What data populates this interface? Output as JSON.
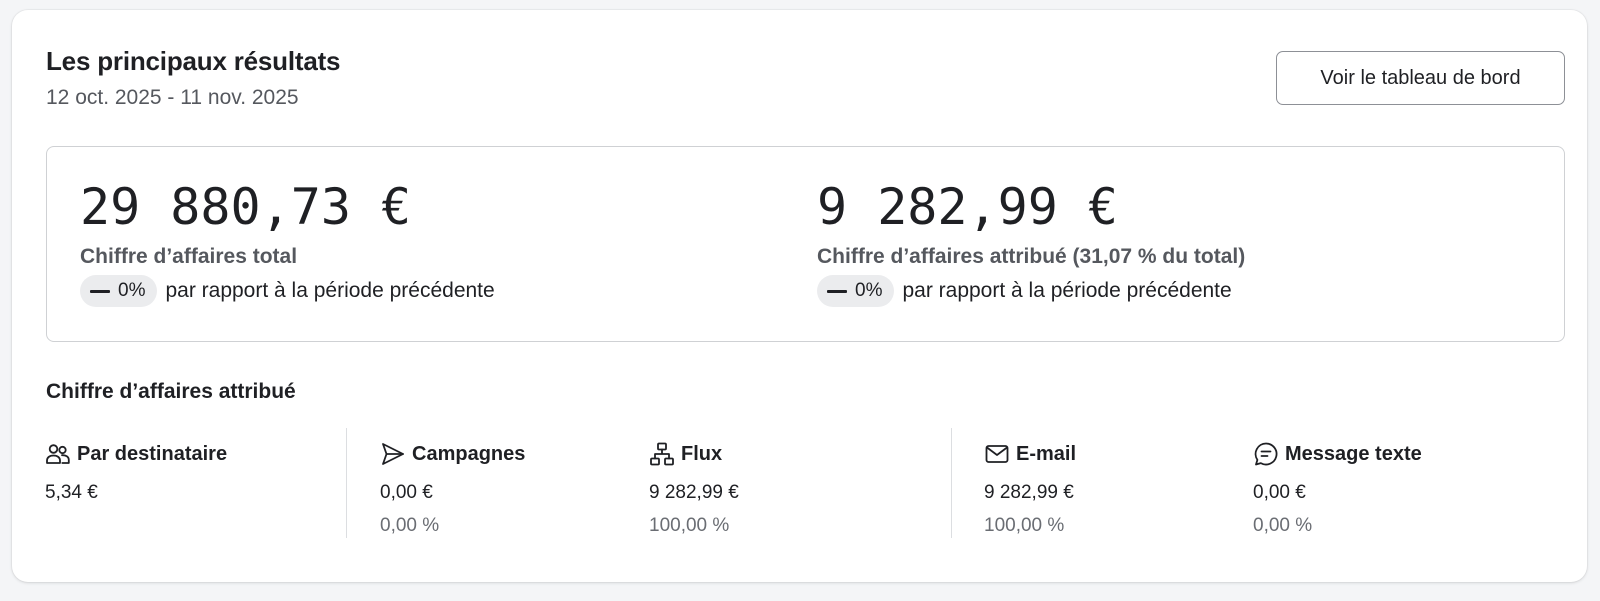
{
  "header": {
    "title": "Les principaux résultats",
    "date_range": "12 oct. 2025 - 11 nov. 2025",
    "dashboard_button": "Voir le tableau de bord"
  },
  "kpis": [
    {
      "value": "29 880,73 €",
      "label": "Chiffre d’affaires total",
      "change": "0%",
      "compare_text": "par rapport à la période précédente"
    },
    {
      "value": "9 282,99 €",
      "label": "Chiffre d’affaires attribué (31,07 % du total)",
      "change": "0%",
      "compare_text": "par rapport à la période précédente"
    }
  ],
  "attributed": {
    "title": "Chiffre d’affaires attribué",
    "stats": [
      {
        "icon": "users-icon",
        "name": "Par destinataire",
        "value": "5,34 €",
        "percent": ""
      },
      {
        "icon": "send-icon",
        "name": "Campagnes",
        "value": "0,00 €",
        "percent": "0,00 %"
      },
      {
        "icon": "flow-icon",
        "name": "Flux",
        "value": "9 282,99 €",
        "percent": "100,00 %"
      },
      {
        "icon": "mail-icon",
        "name": "E-mail",
        "value": "9 282,99 €",
        "percent": "100,00 %"
      },
      {
        "icon": "message-icon",
        "name": "Message texte",
        "value": "0,00 €",
        "percent": "0,00 %"
      }
    ]
  },
  "colors": {
    "card_background": "#ffffff",
    "page_background": "#f4f5f7",
    "text_primary": "#1f2024",
    "text_secondary": "#55585e",
    "pill_background": "#ebecee"
  }
}
